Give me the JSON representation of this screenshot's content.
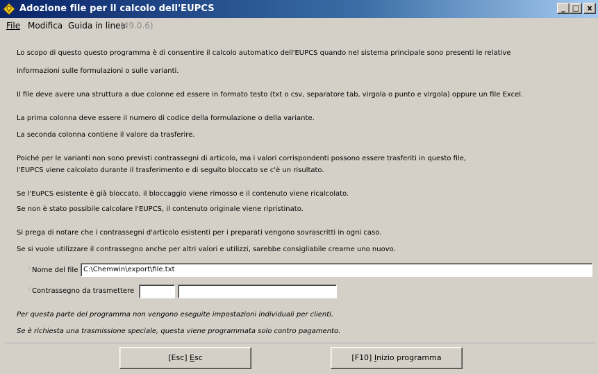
{
  "window": {
    "title": "Adozione file per il calcolo dell'EUPCS",
    "controls": {
      "minimize": "_",
      "maximize": "□",
      "close": "x"
    }
  },
  "menu": {
    "file": "File",
    "modifica": "Modifica",
    "guida": "Guida in linea",
    "version": "(49.0.6)"
  },
  "description": [
    "Lo scopo di questo questo programma è di consentire il calcolo automatico dell'EUPCS quando nel sistema principale sono presenti le relative",
    "informazioni sulle formulazioni o sulle varianti.",
    "Il file deve avere una struttura a due colonne ed essere in formato testo (txt o csv, separatore tab, virgola o punto e virgola) oppure un file Excel.",
    "La prima colonna deve essere il numero di codice della formulazione o della variante.",
    "La seconda colonna contiene il valore da trasferire.",
    "Poiché per le varianti non sono previsti contrassegni di articolo, ma i valori corrispondenti possono essere trasferiti in questo file,",
    "l'EUPCS viene calcolato durante il trasferimento e di seguito bloccato se c'è un risultato.",
    "Se l'EuPCS esistente è già bloccato, il bloccaggio viene rimosso e il contenuto viene ricalcolato.",
    "Se non è stato possibile calcolare l'EUPCS, il contenuto originale viene ripristinato.",
    "Si prega di notare che i contrassegni d'articolo esistenti per i preparati vengono sovrascritti in ogni caso.",
    "Se si vuole utilizzare il contrassegno anche per altri valori e utilizzi, sarebbe consigliabile crearne uno nuovo."
  ],
  "form": {
    "file_mark": "1",
    "file_label": "Nome del file",
    "file_value": "C:\\Chemwin\\export\\file.txt",
    "marker_mark": "2",
    "marker_label": "Contrassegno da trasmettere",
    "marker_code": "",
    "marker_text": ""
  },
  "notes": [
    "Per questa parte del programma non vengono eseguite impostazioni individuali per clienti.",
    "Se è richiesta una trasmissione speciale, questa viene programmata solo contro pagamento."
  ],
  "buttons": {
    "esc_key": "[Esc] ",
    "esc_mnemonic": "E",
    "esc_rest": "sc",
    "start_key": "[F10] ",
    "start_mnemonic": "I",
    "start_rest": "nizio programma"
  },
  "colors": {
    "titlebar_start": "#0a246a",
    "titlebar_end": "#a6caf0",
    "window_bg": "#d4d0c8",
    "version_text": "#8a8a8a"
  }
}
